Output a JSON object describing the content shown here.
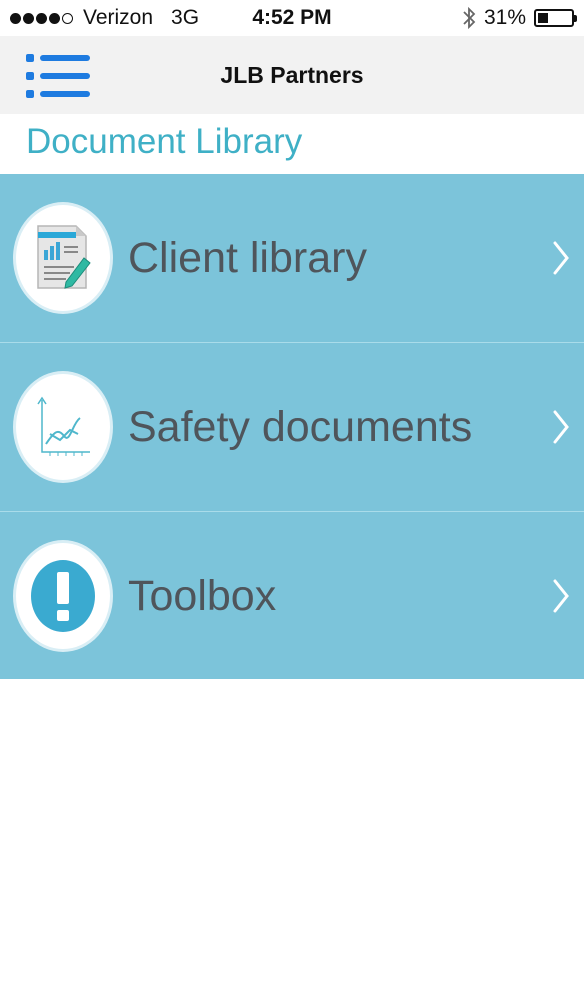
{
  "status_bar": {
    "carrier": "Verizon",
    "network": "3G",
    "time": "4:52 PM",
    "battery_percent": "31%",
    "battery_level": 0.31,
    "icons": [
      "signal-dots-icon",
      "bluetooth-icon",
      "battery-icon"
    ]
  },
  "nav": {
    "title": "JLB Partners",
    "menu_icon": "hamburger-menu-icon",
    "accent": "#1e7be0"
  },
  "section": {
    "title": "Document Library",
    "color": "#3fb0c6"
  },
  "items": [
    {
      "label": "Client library",
      "icon": "document-chart-icon"
    },
    {
      "label": "Safety documents",
      "icon": "line-graph-icon"
    },
    {
      "label": "Toolbox",
      "icon": "exclamation-icon"
    }
  ],
  "colors": {
    "row_background": "#7cc4da",
    "row_text": "#4f555b",
    "chevron": "#ffffff"
  }
}
